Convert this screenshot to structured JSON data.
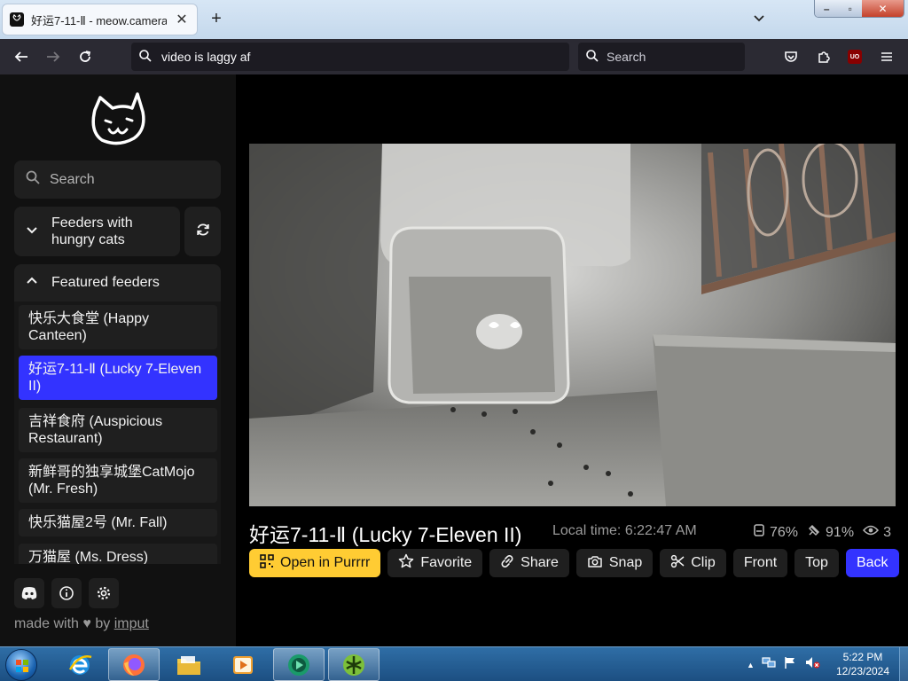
{
  "browser": {
    "tab_title": "好运7-11-Ⅱ - meow.camera",
    "new_tab_symbol": "+",
    "url_text": "video is laggy af",
    "search_placeholder": "Search",
    "ublock_label": "UO"
  },
  "sidebar": {
    "search_placeholder": "Search",
    "group_hungry_label": "Feeders with hungry cats",
    "group_featured_label": "Featured feeders",
    "feeders": [
      {
        "label": "快乐大食堂 (Happy Canteen)",
        "active": false
      },
      {
        "label": "好运7-11-Ⅱ (Lucky 7-Eleven II)",
        "active": true
      },
      {
        "label": "吉祥食府 (Auspicious Restaurant)",
        "active": false
      },
      {
        "label": "新鲜哥的独享城堡CatMojo (Mr. Fresh)",
        "active": false
      },
      {
        "label": "快乐猫屋2号 (Mr. Fall)",
        "active": false
      },
      {
        "label": "万猫屋 (Ms. Dress)",
        "active": false
      }
    ],
    "made_with_prefix": "made with",
    "made_with_by": "by",
    "made_with_author": "imput"
  },
  "main": {
    "camera_title": "好运7-11-Ⅱ (Lucky 7-Eleven II)",
    "local_time": "Local time: 6:22:47 AM",
    "stats": {
      "food_level": "76%",
      "signal": "91%",
      "viewers": "3"
    },
    "actions": {
      "open": "Open in Purrrr",
      "favorite": "Favorite",
      "share": "Share",
      "snap": "Snap",
      "clip": "Clip",
      "front": "Front",
      "top": "Top",
      "back": "Back"
    }
  },
  "taskbar": {
    "time": "5:22 PM",
    "date": "12/23/2024"
  },
  "colors": {
    "accent_blue": "#3333ff",
    "accent_yellow": "#ffcc33",
    "sidebar_bg": "#111111",
    "panel_bg": "#1f1f1f"
  }
}
